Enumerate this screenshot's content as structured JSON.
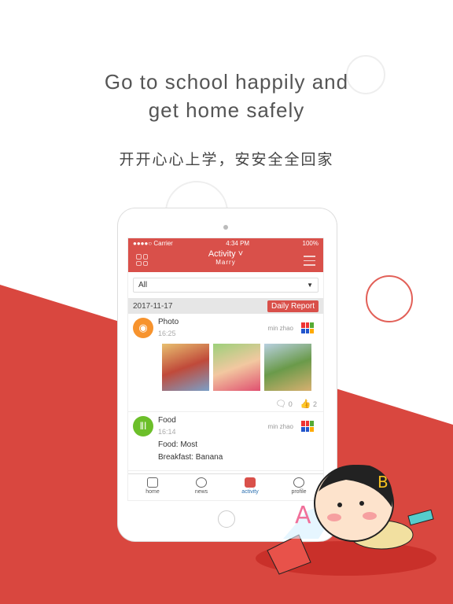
{
  "headline": {
    "line1": "Go to school happily and",
    "line2": "get home safely"
  },
  "subtitle": "开开心心上学，安安全全回家",
  "colors": {
    "brand": "#d9504a",
    "photo_icon": "#f7932d",
    "food_icon": "#6cbf2a",
    "active_tab": "#2a6fb0"
  },
  "app": {
    "status": {
      "carrier": "●●●●○ Carrier",
      "time": "4:34 PM",
      "battery": "100%"
    },
    "header": {
      "title": "Activity",
      "child": "Marry",
      "left_icon": "grid-icon",
      "right_icon": "menu-icon"
    },
    "filter": {
      "value": "All"
    },
    "date": "2017-11-17",
    "daily_report": "Daily Report",
    "feed": [
      {
        "type": "Photo",
        "time": "16:25",
        "author": "min zhao",
        "comments": "0",
        "likes": "2",
        "icon": "camera-icon"
      },
      {
        "type": "Food",
        "time": "16:14",
        "author": "min zhao",
        "icon": "fork-knife-icon",
        "lines": [
          "Food: Most",
          "Breakfast: Banana"
        ]
      }
    ],
    "tabs": [
      {
        "label": "home"
      },
      {
        "label": "news"
      },
      {
        "label": "activity"
      },
      {
        "label": "profile"
      }
    ]
  }
}
